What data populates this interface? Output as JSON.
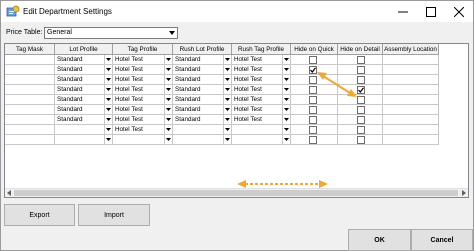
{
  "window": {
    "title": "Edit Department Settings",
    "icons": {
      "app": "settings-app-icon",
      "minimize": "minimize-icon",
      "maximize": "maximize-icon",
      "close": "close-icon"
    }
  },
  "price_table": {
    "label": "Price Table:",
    "value": "General"
  },
  "grid": {
    "columns": [
      "Tag Mask",
      "Lot Profile",
      "Tag Profile",
      "Rush Lot Profile",
      "Rush Tag Profile",
      "Hide on Quick",
      "Hide on Detail",
      "Assembly Location"
    ],
    "rows": [
      {
        "lot": "Standard",
        "tag": "Hotel Test",
        "rush_lot": "Standard",
        "rush_tag": "Hotel Test",
        "hide_quick": false,
        "hide_detail": false
      },
      {
        "lot": "Standard",
        "tag": "Hotel Test",
        "rush_lot": "Standard",
        "rush_tag": "Hotel Test",
        "hide_quick": true,
        "hide_detail": false
      },
      {
        "lot": "Standard",
        "tag": "Hotel Test",
        "rush_lot": "Standard",
        "rush_tag": "Hotel Test",
        "hide_quick": false,
        "hide_detail": false
      },
      {
        "lot": "Standard",
        "tag": "Hotel Test",
        "rush_lot": "Standard",
        "rush_tag": "Hotel Test",
        "hide_quick": false,
        "hide_detail": true
      },
      {
        "lot": "Standard",
        "tag": "Hotel Test",
        "rush_lot": "Standard",
        "rush_tag": "Hotel Test",
        "hide_quick": false,
        "hide_detail": false
      },
      {
        "lot": "Standard",
        "tag": "Hotel Test",
        "rush_lot": "Standard",
        "rush_tag": "Hotel Test",
        "hide_quick": false,
        "hide_detail": false
      },
      {
        "lot": "Standard",
        "tag": "Hotel Test",
        "rush_lot": "Standard",
        "rush_tag": "Hotel Test",
        "hide_quick": false,
        "hide_detail": false
      },
      {
        "lot": "",
        "tag": "Hotel Test",
        "rush_lot": "",
        "rush_tag": "",
        "hide_quick": false,
        "hide_detail": false
      },
      {
        "lot": "",
        "tag": "",
        "rush_lot": "",
        "rush_tag": "",
        "hide_quick": false,
        "hide_detail": false
      }
    ],
    "accent_arrow_color": "#f0a830"
  },
  "buttons": {
    "export": "Export",
    "import": "Import",
    "ok": "OK",
    "cancel": "Cancel"
  }
}
